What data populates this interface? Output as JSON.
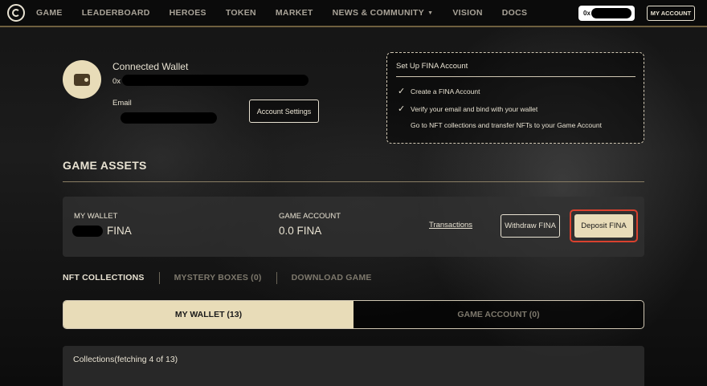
{
  "nav": {
    "items": [
      {
        "label": "GAME"
      },
      {
        "label": "LEADERBOARD"
      },
      {
        "label": "HEROES"
      },
      {
        "label": "TOKEN"
      },
      {
        "label": "MARKET"
      },
      {
        "label": "NEWS & COMMUNITY"
      },
      {
        "label": "VISION"
      },
      {
        "label": "DOCS"
      }
    ],
    "wallet_prefix": "0x",
    "my_account_label": "MY ACCOUNT"
  },
  "profile": {
    "title": "Connected Wallet",
    "address_prefix": "0x",
    "email_label": "Email",
    "account_settings_label": "Account Settings"
  },
  "setup": {
    "title": "Set Up FINA Account",
    "steps": [
      {
        "label": "Create a FINA Account",
        "done": true
      },
      {
        "label": "Verify your email and bind with your wallet",
        "done": true
      },
      {
        "label": "Go to NFT collections and transfer NFTs to your Game Account",
        "done": false
      }
    ]
  },
  "assets": {
    "title": "GAME ASSETS",
    "my_wallet_label": "MY WALLET",
    "my_wallet_value": "FINA",
    "game_account_label": "GAME ACCOUNT",
    "game_account_value": "0.0 FINA",
    "transactions_label": "Transactions",
    "withdraw_label": "Withdraw FINA",
    "deposit_label": "Deposit FINA"
  },
  "tabs": [
    {
      "label": "NFT COLLECTIONS",
      "active": true
    },
    {
      "label": "MYSTERY BOXES (0)",
      "active": false
    },
    {
      "label": "DOWNLOAD GAME",
      "active": false
    }
  ],
  "segments": [
    {
      "label": "MY WALLET (13)",
      "active": true
    },
    {
      "label": "GAME ACCOUNT (0)",
      "active": false
    }
  ],
  "collections": {
    "status": "Collections(fetching 4 of 13)"
  }
}
